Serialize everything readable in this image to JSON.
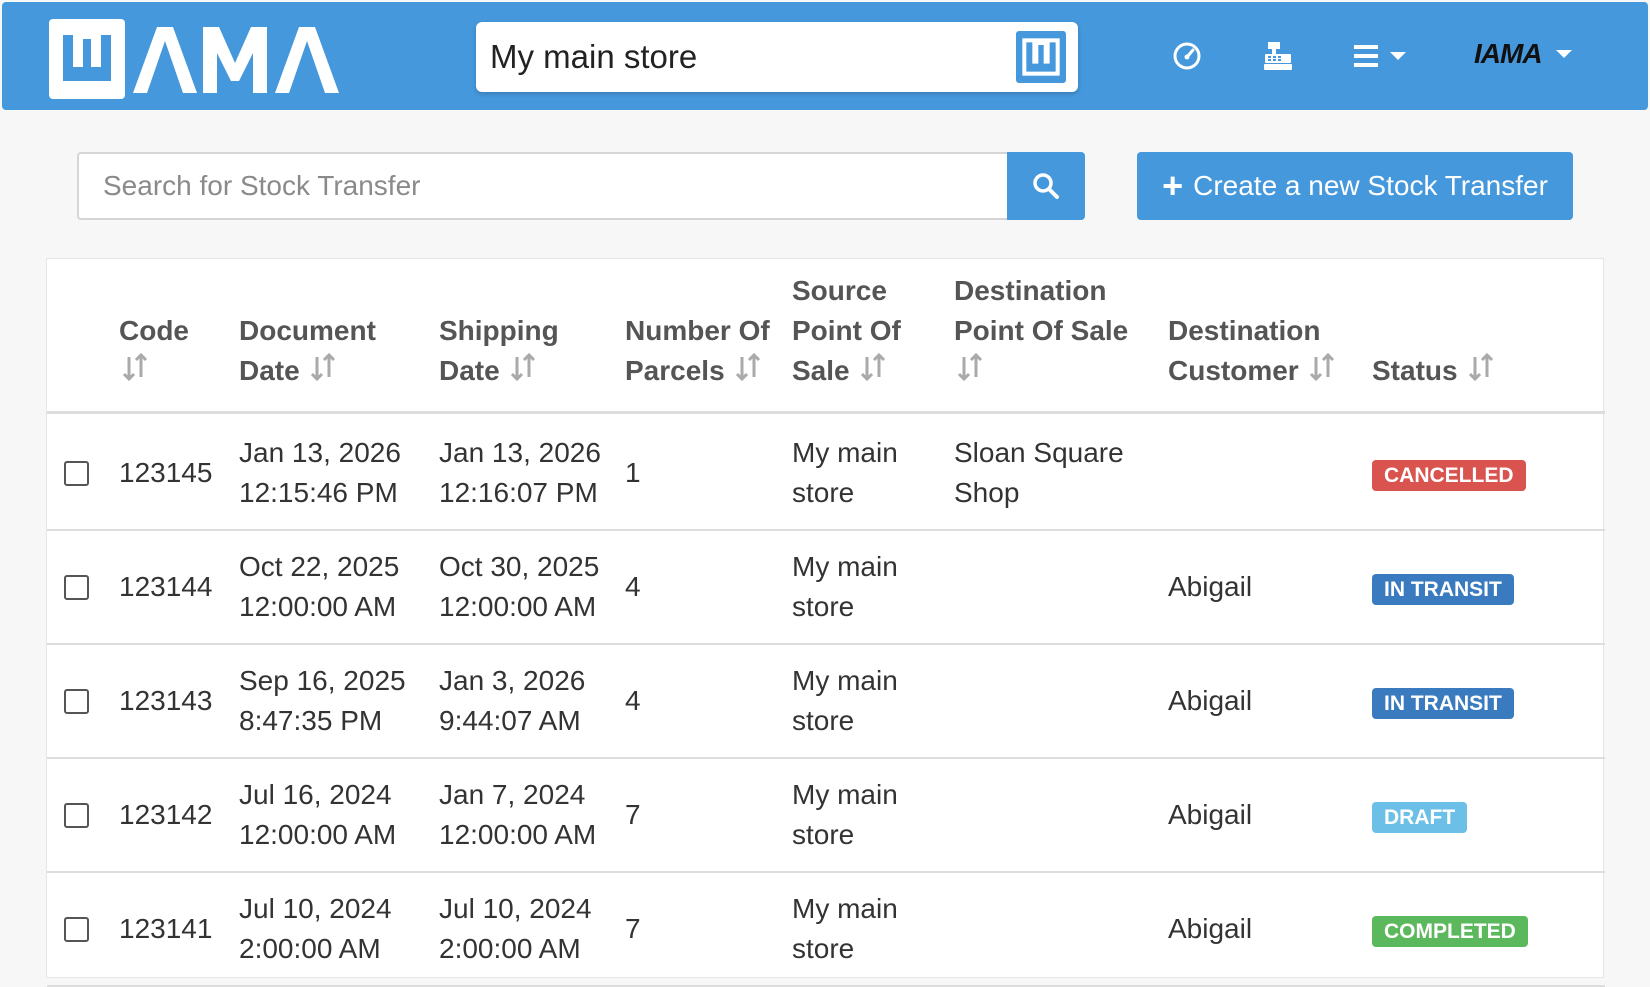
{
  "navbar": {
    "logo_text": "WAMA",
    "store_name": "My main store",
    "icons": [
      "dashboard-icon",
      "cash-register-icon",
      "menu-icon"
    ],
    "user_name": "IAMA"
  },
  "search": {
    "placeholder": "Search for Stock Transfer",
    "value": ""
  },
  "create_button": {
    "label": "Create a new Stock Transfer"
  },
  "table": {
    "columns": [
      {
        "line1": "Code",
        "line2": "",
        "line3": ""
      },
      {
        "line1": "Document",
        "line2": "Date",
        "line3": ""
      },
      {
        "line1": "Shipping",
        "line2": "Date",
        "line3": ""
      },
      {
        "line1": "Number Of",
        "line2": "Parcels",
        "line3": ""
      },
      {
        "line1": "Source",
        "line2": "Point Of",
        "line3": "Sale"
      },
      {
        "line1": "Destination",
        "line2": "Point Of Sale",
        "line3": ""
      },
      {
        "line1": "Destination",
        "line2": "Customer",
        "line3": ""
      },
      {
        "line1": "Status",
        "line2": "",
        "line3": ""
      }
    ],
    "rows": [
      {
        "code": "123145",
        "document_date": "Jan 13, 2026\n12:15:46 PM",
        "shipping_date": "Jan 13, 2026\n12:16:07 PM",
        "parcels": "1",
        "source_pos": "My main\nstore",
        "destination_pos": "Sloan Square\nShop",
        "destination_customer": "",
        "status": "CANCELLED",
        "status_color": "#d9534f"
      },
      {
        "code": "123144",
        "document_date": "Oct 22, 2025\n12:00:00 AM",
        "shipping_date": "Oct 30, 2025\n12:00:00 AM",
        "parcels": "4",
        "source_pos": "My main\nstore",
        "destination_pos": "",
        "destination_customer": "Abigail",
        "status": "IN TRANSIT",
        "status_color": "#3a7bbf"
      },
      {
        "code": "123143",
        "document_date": "Sep 16, 2025\n8:47:35 PM",
        "shipping_date": "Jan 3, 2026\n9:44:07 AM",
        "parcels": "4",
        "source_pos": "My main\nstore",
        "destination_pos": "",
        "destination_customer": "Abigail",
        "status": "IN TRANSIT",
        "status_color": "#3a7bbf"
      },
      {
        "code": "123142",
        "document_date": "Jul 16, 2024\n12:00:00 AM",
        "shipping_date": "Jan 7, 2024\n12:00:00 AM",
        "parcels": "7",
        "source_pos": "My main\nstore",
        "destination_pos": "",
        "destination_customer": "Abigail",
        "status": "DRAFT",
        "status_color": "#6cbfe6"
      },
      {
        "code": "123141",
        "document_date": "Jul 10, 2024\n2:00:00 AM",
        "shipping_date": "Jul 10, 2024\n2:00:00 AM",
        "parcels": "7",
        "source_pos": "My main\nstore",
        "destination_pos": "",
        "destination_customer": "Abigail",
        "status": "COMPLETED",
        "status_color": "#5cb85c"
      }
    ]
  },
  "colors": {
    "brand_blue": "#4598db",
    "cancelled": "#d9534f",
    "in_transit": "#3a7bbf",
    "draft": "#6cbfe6",
    "completed": "#5cb85c"
  }
}
